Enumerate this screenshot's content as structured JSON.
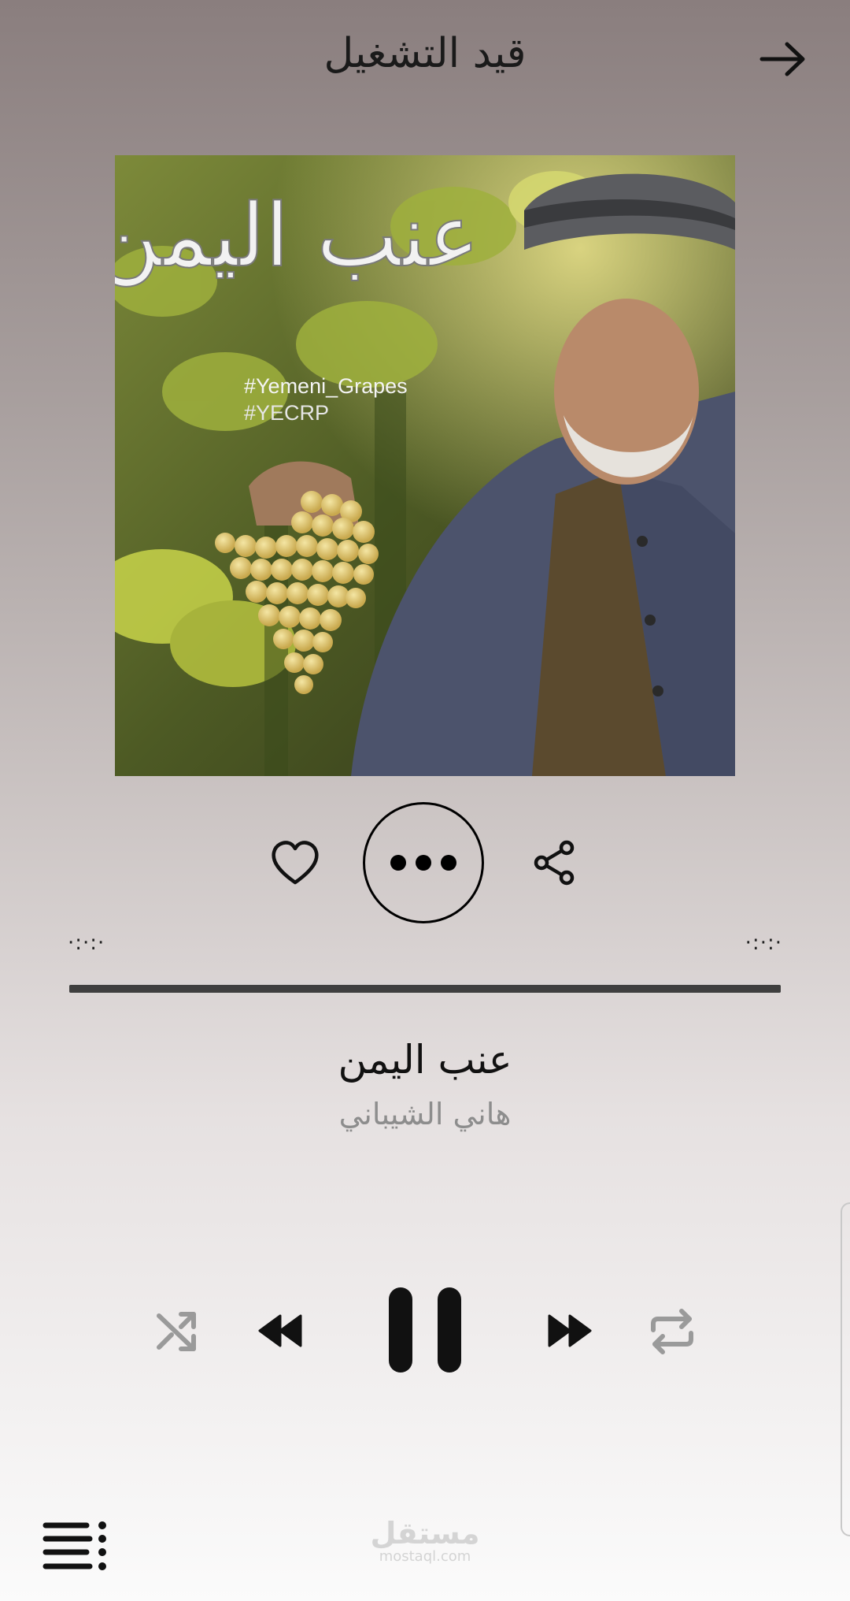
{
  "header": {
    "title": "قيد التشغيل",
    "back_icon": "arrow-right-icon"
  },
  "album_art": {
    "title_calligraphy": "عنب اليمن",
    "hashtag_1": "#Yemeni_Grapes",
    "hashtag_2": "#YECRP"
  },
  "actions": {
    "like_icon": "heart-outline-icon",
    "more_icon": "more-horizontal-icon",
    "share_icon": "share-icon"
  },
  "progress": {
    "elapsed": "·:·:·",
    "total": "·:·:·",
    "fraction": 1.0
  },
  "track": {
    "title": "عنب اليمن",
    "artist": "هاني الشيباني"
  },
  "controls": {
    "shuffle_icon": "shuffle-icon",
    "previous_icon": "previous-icon",
    "play_pause_icon": "pause-icon",
    "next_icon": "next-icon",
    "repeat_icon": "repeat-icon"
  },
  "footer": {
    "queue_icon": "queue-list-icon",
    "watermark_ar": "مستقل",
    "watermark_en": "mostaql.com"
  },
  "colors": {
    "background_top": "#8a7e7e",
    "background_bottom": "#fbfbfb",
    "progress": "#5a5a5a",
    "artist_text": "#8d8d8d",
    "inactive_control": "#9a9a9a"
  }
}
